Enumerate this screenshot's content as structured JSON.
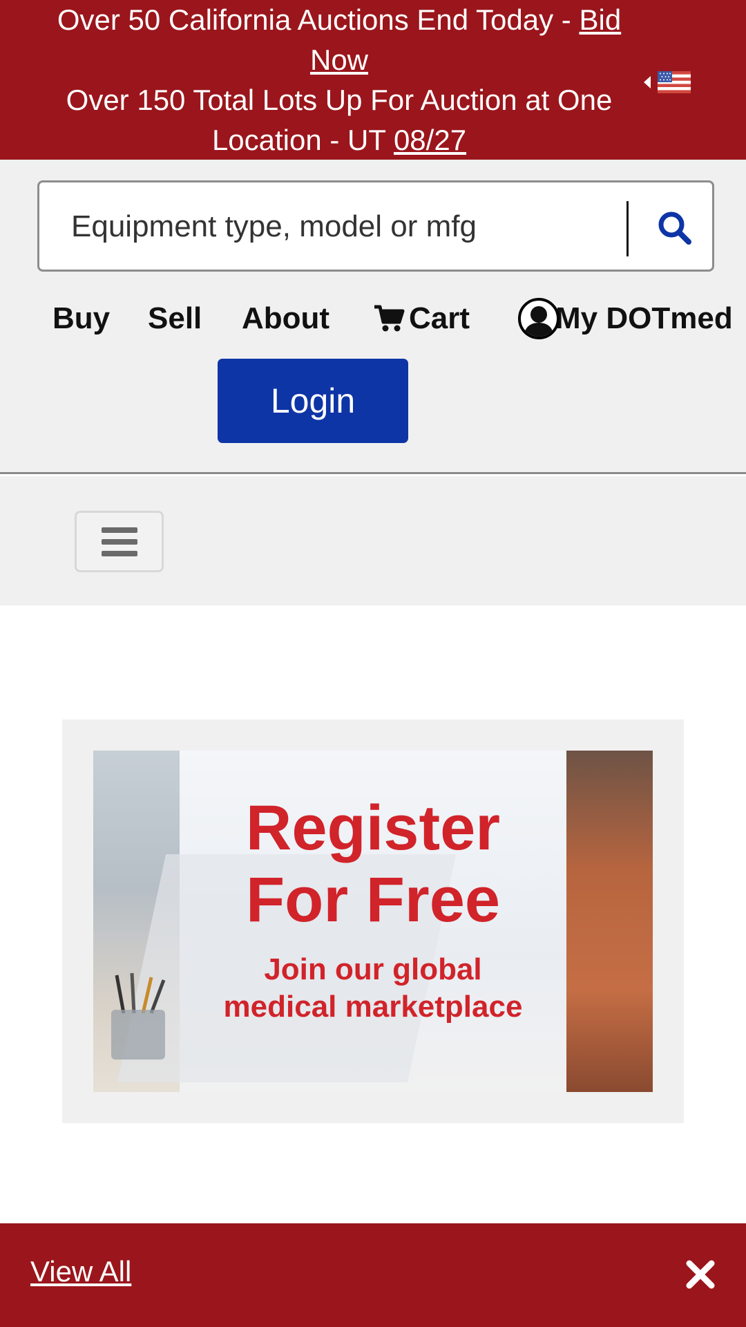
{
  "banner": {
    "line1_prefix": "Over 50 California Auctions End Today - ",
    "line1_link": "Bid Now",
    "line2_prefix": "Over 150 Total Lots Up For Auction at One Location - UT ",
    "line2_link": "08/27",
    "flag_icon": "us-flag-icon"
  },
  "search": {
    "placeholder": "Equipment type, model or mfg",
    "button_icon": "search-icon"
  },
  "nav": {
    "buy": "Buy",
    "sell": "Sell",
    "about": "About",
    "cart": "Cart",
    "my_account": "My DOTmed"
  },
  "login": {
    "label": "Login"
  },
  "ad": {
    "title_line1": "Register",
    "title_line2": "For Free",
    "subtitle_line1": "Join our global",
    "subtitle_line2": "medical marketplace"
  },
  "footer": {
    "view_all": "View All",
    "close_icon": "close-icon"
  },
  "colors": {
    "banner_red": "#9a161c",
    "login_blue": "#0e35a6",
    "ad_red": "#d1232a",
    "search_icon_blue": "#0e35a6"
  }
}
